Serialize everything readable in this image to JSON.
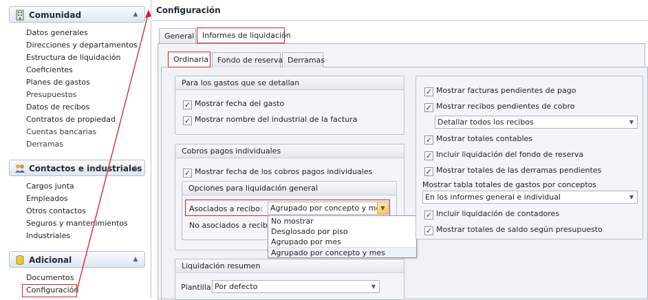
{
  "colors": {
    "annotation": "#e0191a",
    "panel": "#f0f2f5",
    "border": "#a9b6c6"
  },
  "nav": {
    "groups": [
      {
        "title": "Comunidad",
        "icon": "building-icon",
        "items": [
          "Datos generales",
          "Direcciones y departamentos",
          "Estructura de liquidación",
          "Coeficientes",
          "Planes de gastos",
          "Presupuestos",
          "Datos de recibos",
          "Contratos de propiedad",
          "Cuentas bancarias",
          "Derramas"
        ]
      },
      {
        "title": "Contactos e industriales",
        "icon": "contacts-icon",
        "items": [
          "Cargos junta",
          "Empleados",
          "Otros contactos",
          "Seguros y mantenimientos",
          "Industriales"
        ]
      },
      {
        "title": "Adicional",
        "icon": "database-icon",
        "items": [
          "Documentos",
          "Configuración"
        ]
      }
    ]
  },
  "main": {
    "title": "Configuración",
    "outer_tabs": [
      "General",
      "Informes de liquidación"
    ],
    "inner_tabs": [
      "Ordinaria",
      "Fondo de reserva",
      "Derramas"
    ]
  },
  "left": {
    "detail_group": {
      "title": "Para los gastos que se detallan",
      "checks": [
        {
          "label": "Mostrar fecha del gasto",
          "checked": true
        },
        {
          "label": "Mostrar nombre del industrial de la factura",
          "checked": true
        }
      ]
    },
    "cobros_group": {
      "title": "Cobros pagos individuales",
      "check": {
        "label": "Mostrar fecha de los cobros pagos individuales",
        "checked": true
      },
      "sub_title": "Opciones para liquidación general",
      "asociados_label": "Asociados a recibo:",
      "asociados_value": "Agrupado por concepto y mes",
      "no_asociados_label": "No asociados a recibo:"
    },
    "dropdown_options": [
      "No mostrar",
      "Desglosado por piso",
      "Agrupado por mes",
      "Agrupado por concepto y mes"
    ],
    "resumen_group": {
      "title": "Liquidación resumen",
      "plantilla_label": "Plantilla:",
      "plantilla_value": "Por defecto"
    }
  },
  "right": {
    "checks_top": [
      {
        "label": "Mostrar facturas pendientes de pago",
        "checked": true
      },
      {
        "label": "Mostrar recibos pendientes de cobro",
        "checked": true
      }
    ],
    "recibos_combo": "Detallar todos los recibos",
    "checks_mid": [
      {
        "label": "Mostrar totales contables",
        "checked": true
      },
      {
        "label": "Incluir liquidación del fondo de reserva",
        "checked": true
      },
      {
        "label": "Mostrar totales de las derramas pendientes",
        "checked": true
      }
    ],
    "tabla_label": "Mostrar tabla totales de gastos por conceptos",
    "tabla_combo": "En los informes general e individual",
    "checks_bottom": [
      {
        "label": "Incluir liquidación de contadores",
        "checked": true
      },
      {
        "label": "Mostrar totales de saldo según presupuesto",
        "checked": true
      }
    ]
  }
}
